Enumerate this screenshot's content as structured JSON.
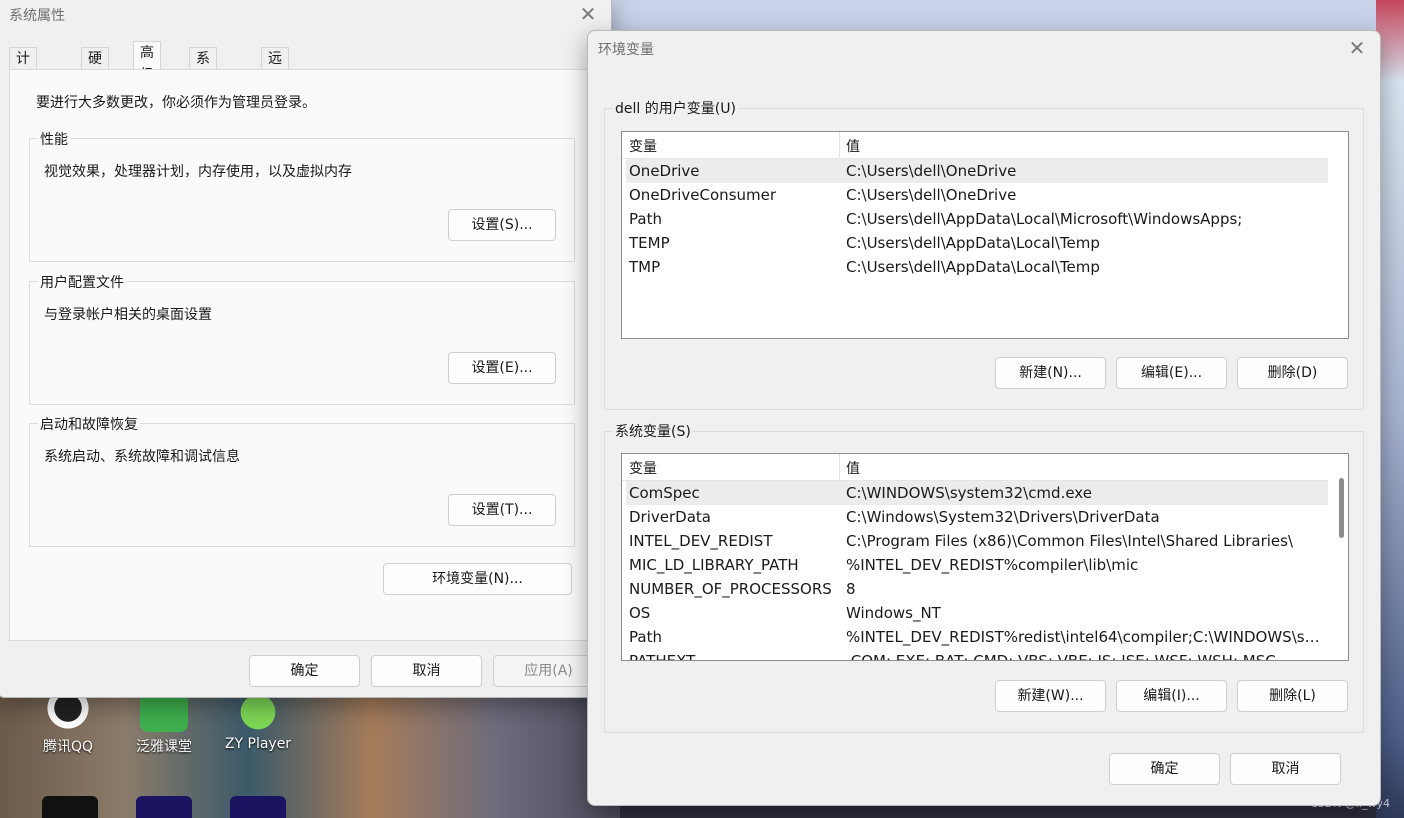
{
  "desktop": {
    "icons": [
      {
        "label": "腾讯QQ"
      },
      {
        "label": "泛雅课堂"
      },
      {
        "label": "ZY Player"
      }
    ],
    "watermark": "CSDN @ll_wy4"
  },
  "system_properties": {
    "title": "系统属性",
    "tabs": [
      "计算机名",
      "硬件",
      "高级",
      "系统保护",
      "远程"
    ],
    "active_tab": "高级",
    "admin_notice": "要进行大多数更改，你必须作为管理员登录。",
    "groups": [
      {
        "title": "性能",
        "description": "视觉效果，处理器计划，内存使用，以及虚拟内存",
        "button": "设置(S)..."
      },
      {
        "title": "用户配置文件",
        "description": "与登录帐户相关的桌面设置",
        "button": "设置(E)..."
      },
      {
        "title": "启动和故障恢复",
        "description": "系统启动、系统故障和调试信息",
        "button": "设置(T)..."
      }
    ],
    "env_button": "环境变量(N)...",
    "footer": {
      "ok": "确定",
      "cancel": "取消",
      "apply": "应用(A)"
    }
  },
  "env_vars": {
    "title": "环境变量",
    "user_section": {
      "title": "dell 的用户变量(U)",
      "columns": [
        "变量",
        "值"
      ],
      "rows": [
        {
          "name": "OneDrive",
          "value": "C:\\Users\\dell\\OneDrive"
        },
        {
          "name": "OneDriveConsumer",
          "value": "C:\\Users\\dell\\OneDrive"
        },
        {
          "name": "Path",
          "value": "C:\\Users\\dell\\AppData\\Local\\Microsoft\\WindowsApps;"
        },
        {
          "name": "TEMP",
          "value": "C:\\Users\\dell\\AppData\\Local\\Temp"
        },
        {
          "name": "TMP",
          "value": "C:\\Users\\dell\\AppData\\Local\\Temp"
        }
      ],
      "buttons": {
        "new": "新建(N)...",
        "edit": "编辑(E)...",
        "delete": "删除(D)"
      }
    },
    "system_section": {
      "title": "系统变量(S)",
      "columns": [
        "变量",
        "值"
      ],
      "rows": [
        {
          "name": "ComSpec",
          "value": "C:\\WINDOWS\\system32\\cmd.exe"
        },
        {
          "name": "DriverData",
          "value": "C:\\Windows\\System32\\Drivers\\DriverData"
        },
        {
          "name": "INTEL_DEV_REDIST",
          "value": "C:\\Program Files (x86)\\Common Files\\Intel\\Shared Libraries\\"
        },
        {
          "name": "MIC_LD_LIBRARY_PATH",
          "value": "%INTEL_DEV_REDIST%compiler\\lib\\mic"
        },
        {
          "name": "NUMBER_OF_PROCESSORS",
          "value": "8"
        },
        {
          "name": "OS",
          "value": "Windows_NT"
        },
        {
          "name": "Path",
          "value": "%INTEL_DEV_REDIST%redist\\intel64\\compiler;C:\\WINDOWS\\sys..."
        },
        {
          "name": "PATHEXT",
          "value": ".COM;.EXE;.BAT;.CMD;.VBS;.VBE;.JS;.JSE;.WSF;.WSH;.MSC"
        }
      ],
      "buttons": {
        "new": "新建(W)...",
        "edit": "编辑(I)...",
        "delete": "删除(L)"
      }
    },
    "footer": {
      "ok": "确定",
      "cancel": "取消"
    }
  }
}
